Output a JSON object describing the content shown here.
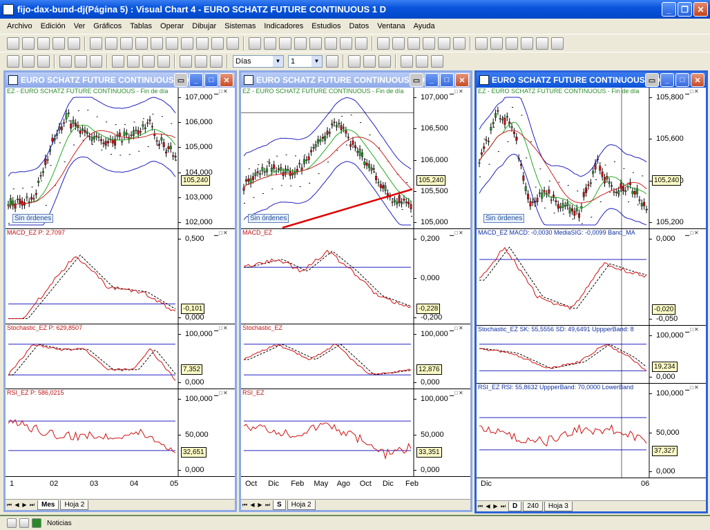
{
  "app": {
    "title": "fijo-dax-bund-dj(Página 5) : Visual Chart 4 - EURO SCHATZ FUTURE CONTINUOUS 1 D"
  },
  "menu": [
    "Archivo",
    "Edición",
    "Ver",
    "Gráficos",
    "Tablas",
    "Operar",
    "Dibujar",
    "Sistemas",
    "Indicadores",
    "Estudios",
    "Datos",
    "Ventana",
    "Ayuda"
  ],
  "toolbar": {
    "period_value": "Días",
    "compression_value": "1"
  },
  "status": {
    "item": "Noticias"
  },
  "colors": {
    "up": "#2a9a2a",
    "down": "#d01010",
    "ma_green": "#22aa22",
    "ma_red": "#cc2222",
    "band": "#2020c0"
  },
  "windows": [
    {
      "title": "EURO SCHATZ FUTURE CONTINUOUS 1 D",
      "active": false,
      "price_title": "EZ - EURO SCHATZ FUTURE CONTINUOUS - Fin de día",
      "price_axis": [
        "107,000",
        "106,000",
        "105,000",
        "104,000",
        "103,000",
        "102,000"
      ],
      "price_last": "105,240",
      "sin_ordenes": "Sin órdenes",
      "macd_title": "MACD_EZ  P: 2,7097",
      "macd_axis": [
        "0,500",
        "0,000"
      ],
      "macd_last": "-0,101",
      "stoch_title": "Stochastic_EZ  P: 629,8507",
      "stoch_axis": [
        "100,000",
        "0,000"
      ],
      "stoch_last": "7,352",
      "rsi_title": "RSI_EZ  P: 586,0215",
      "rsi_axis": [
        "100,000",
        "50,000",
        "0,000"
      ],
      "rsi_last": "32,651",
      "x_labels": [
        "1",
        "02",
        "03",
        "04",
        "05"
      ],
      "tabs": [
        "Mes",
        "Hoja 2"
      ]
    },
    {
      "title": "EURO SCHATZ FUTURE CONTINUOUS 1 D",
      "active": false,
      "price_title": "EZ - EURO SCHATZ FUTURE CONTINUOUS - Fin de día",
      "price_axis": [
        "107,000",
        "106,500",
        "106,000",
        "105,500",
        "105,000"
      ],
      "price_last": "105,240",
      "sin_ordenes": "Sin órdenes",
      "macd_title": "MACD_EZ",
      "macd_axis": [
        "0,200",
        "0,000",
        "-0,200"
      ],
      "macd_last": "-0,228",
      "stoch_title": "Stochastic_EZ",
      "stoch_axis": [
        "100,000",
        "0,000"
      ],
      "stoch_last": "12,876",
      "rsi_title": "RSI_EZ",
      "rsi_axis": [
        "100,000",
        "50,000",
        "0,000"
      ],
      "rsi_last": "33,351",
      "x_labels": [
        "Oct",
        "Dic",
        "Feb",
        "May",
        "Ago",
        "Oct",
        "Dic",
        "Feb"
      ],
      "tabs": [
        "S",
        "Hoja 2"
      ]
    },
    {
      "title": "EURO SCHATZ FUTURE CONTINUOUS 1 D",
      "active": true,
      "price_title": "EZ - EURO SCHATZ FUTURE CONTINUOUS - Fin de día",
      "price_axis": [
        "105,800",
        "105,600",
        "105,400",
        "105,200"
      ],
      "price_last": "105,240",
      "sin_ordenes": "Sin órdenes",
      "macd_title": "MACD_EZ  MACD: -0,0030  MediaSIG: -0,0099  Band_MA",
      "macd_axis": [
        "0,000",
        "-0,050"
      ],
      "macd_last": "-0,020",
      "stoch_title": "Stochastic_EZ  SK: 55,5556  SD: 49,6491  UppperBand: 8",
      "stoch_axis": [
        "100,000",
        "0,000"
      ],
      "stoch_last": "19,234",
      "rsi_title": "RSI_EZ  RSI: 55,8632  UppperBand: 70,0000  LowerBand",
      "rsi_axis": [
        "100,000",
        "50,000",
        "0,000"
      ],
      "rsi_last": "37,327",
      "x_labels": [
        "Dic",
        "06"
      ],
      "tabs": [
        "D",
        "240",
        "Hoja 3"
      ]
    }
  ]
}
